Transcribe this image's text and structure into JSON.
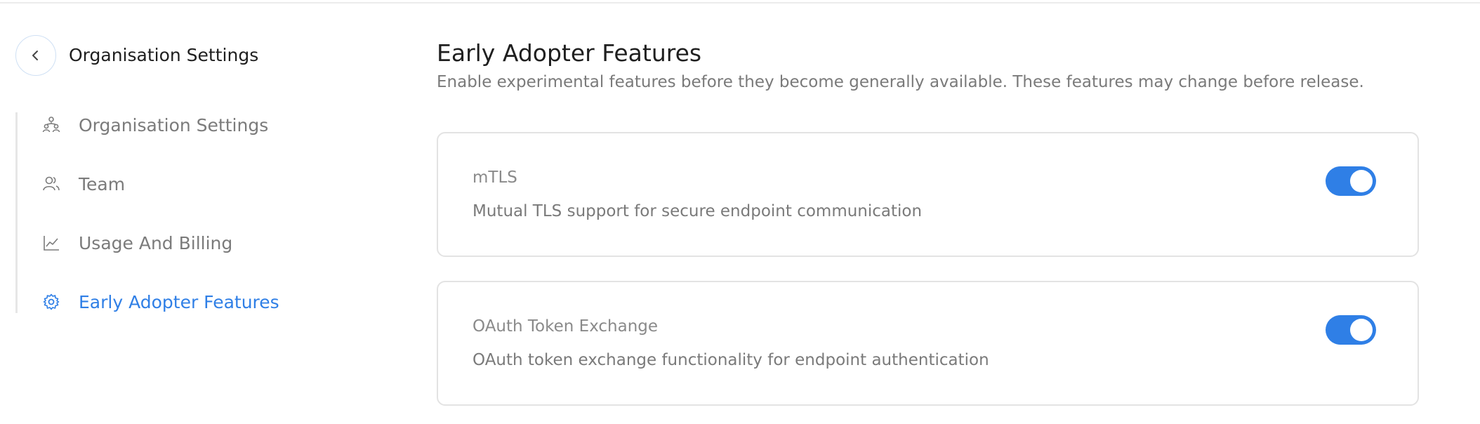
{
  "sidebar": {
    "back_icon": "chevron-left-icon",
    "title": "Organisation Settings",
    "items": [
      {
        "label": "Organisation Settings",
        "icon": "org-people-icon",
        "active": false
      },
      {
        "label": "Team",
        "icon": "users-icon",
        "active": false
      },
      {
        "label": "Usage And Billing",
        "icon": "line-chart-icon",
        "active": false
      },
      {
        "label": "Early Adopter Features",
        "icon": "gear-icon",
        "active": true
      }
    ]
  },
  "main": {
    "title": "Early Adopter Features",
    "subtitle": "Enable experimental features before they become generally available. These features may change before release.",
    "features": [
      {
        "name": "mTLS",
        "description": "Mutual TLS support for secure endpoint communication",
        "enabled": true
      },
      {
        "name": "OAuth Token Exchange",
        "description": "OAuth token exchange functionality for endpoint authentication",
        "enabled": true
      }
    ]
  },
  "colors": {
    "accent": "#2f7fe6",
    "text_primary": "#1f1f1f",
    "text_muted": "#7b7b7b",
    "card_border": "#e3e3e3"
  }
}
